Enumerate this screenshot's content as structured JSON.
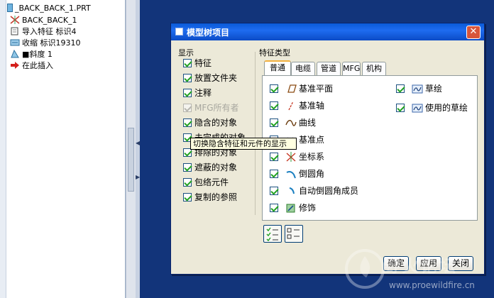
{
  "tree": {
    "root": "_BACK_BACK_1.PRT",
    "items": [
      {
        "label": "BACK_BACK_1",
        "icon": "csys-icon"
      },
      {
        "label": "导入特征 标识4",
        "icon": "import-feature-icon"
      },
      {
        "label": "收缩 标识19310",
        "icon": "shrink-icon"
      },
      {
        "label": "■斜度 1",
        "icon": "draft-icon"
      },
      {
        "label": "在此插入",
        "icon": "insert-here-arrow-icon"
      }
    ]
  },
  "dialog": {
    "title": "模型树项目",
    "close_glyph": "✕",
    "display_label": "显示",
    "display_items": [
      {
        "label": "特征",
        "checked": true,
        "enabled": true
      },
      {
        "label": "放置文件夹",
        "checked": true,
        "enabled": true
      },
      {
        "label": "注释",
        "checked": true,
        "enabled": true
      },
      {
        "label": "MFG所有者",
        "checked": true,
        "enabled": false
      },
      {
        "label": "隐含的对象",
        "checked": true,
        "enabled": true
      },
      {
        "label": "未完成的对象",
        "checked": true,
        "enabled": true
      },
      {
        "label": "排除的对象",
        "checked": true,
        "enabled": true
      },
      {
        "label": "遮蔽的对象",
        "checked": true,
        "enabled": true
      },
      {
        "label": "包络元件",
        "checked": true,
        "enabled": true
      },
      {
        "label": "复制的参照",
        "checked": true,
        "enabled": true
      }
    ],
    "feature_type_label": "特征类型",
    "tabs": [
      "普通",
      "电缆",
      "管道",
      "MFG",
      "机构"
    ],
    "active_tab": "普通",
    "features_left": [
      {
        "label": "基准平面",
        "icon": "datum-plane-icon"
      },
      {
        "label": "基准轴",
        "icon": "datum-axis-icon"
      },
      {
        "label": "曲线",
        "icon": "curve-icon"
      },
      {
        "label": "基准点",
        "icon": "datum-point-icon"
      },
      {
        "label": "坐标系",
        "icon": "coordinate-system-icon"
      },
      {
        "label": "倒圆角",
        "icon": "round-icon"
      },
      {
        "label": "自动倒圆角成员",
        "icon": "auto-round-member-icon"
      },
      {
        "label": "修饰",
        "icon": "cosmetic-icon"
      }
    ],
    "features_right": [
      {
        "label": "草绘",
        "icon": "sketch-icon"
      },
      {
        "label": "使用的草绘",
        "icon": "used-sketch-icon"
      }
    ],
    "tooltip": "切换隐含特征和元件的显示",
    "buttons": {
      "ok": "确定",
      "apply": "应用",
      "close": "关闭"
    }
  },
  "watermark": {
    "text": "野火论坛",
    "url": "www.proewildfire.cn"
  },
  "colors": {
    "desktop": "#12347a",
    "title_bar": "#0a5ad8",
    "check_mark": "#21a121"
  }
}
